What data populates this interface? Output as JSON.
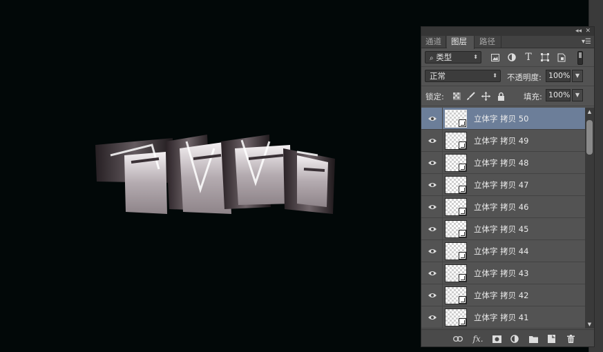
{
  "panel": {
    "tabs": [
      {
        "label": "通道",
        "active": false
      },
      {
        "label": "图层",
        "active": true
      },
      {
        "label": "路径",
        "active": false
      }
    ],
    "filter_kind": "类型",
    "blend_mode": "正常",
    "opacity_label": "不透明度:",
    "opacity_value": "100%",
    "lock_label": "锁定:",
    "fill_label": "填充:",
    "fill_value": "100%",
    "layers": [
      {
        "name": "立体字 拷贝 50",
        "selected": true
      },
      {
        "name": "立体字 拷贝 49",
        "selected": false
      },
      {
        "name": "立体字 拷贝 48",
        "selected": false
      },
      {
        "name": "立体字 拷贝 47",
        "selected": false
      },
      {
        "name": "立体字 拷贝 46",
        "selected": false
      },
      {
        "name": "立体字 拷贝 45",
        "selected": false
      },
      {
        "name": "立体字 拷贝 44",
        "selected": false
      },
      {
        "name": "立体字 拷贝 43",
        "selected": false
      },
      {
        "name": "立体字 拷贝 42",
        "selected": false
      },
      {
        "name": "立体字 拷贝 41",
        "selected": false
      }
    ],
    "colors": {
      "selected_row": "#6c7e99",
      "panel_bg": "#535353",
      "canvas_bg": "#020808"
    }
  }
}
